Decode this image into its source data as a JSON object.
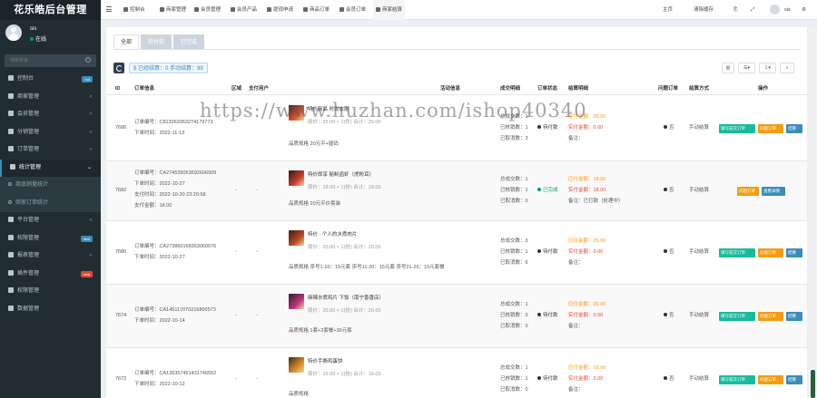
{
  "app": {
    "title": "花乐皓后台管理"
  },
  "user": {
    "name": "sis",
    "status": "在线"
  },
  "sidebar": {
    "search_placeholder": "搜索菜单",
    "items": [
      {
        "label": "控制台",
        "badge": "hot",
        "badge_color": "#3c8dbc"
      },
      {
        "label": "商家管理",
        "arrow": "‹"
      },
      {
        "label": "会员管理",
        "arrow": "‹"
      },
      {
        "label": "分销管理",
        "arrow": "‹"
      },
      {
        "label": "订单管理",
        "arrow": "‹"
      },
      {
        "label": "统计管理",
        "arrow": "⌄"
      },
      {
        "label": "商品销量统计"
      },
      {
        "label": "商家订单统计"
      },
      {
        "label": "平台管理",
        "arrow": "‹"
      },
      {
        "label": "权限管理",
        "badge": "new",
        "badge_color": "#3c8dbc"
      },
      {
        "label": "报表管理",
        "arrow": "‹"
      },
      {
        "label": "插件管理",
        "badge": "new",
        "badge_color": "#dd4b39"
      },
      {
        "label": "权限管理"
      },
      {
        "label": "数据管理"
      }
    ]
  },
  "topnav": {
    "items": [
      "控制台",
      "商家管理",
      "会员管理",
      "会员产品",
      "提现申请",
      "商品订单",
      "会员订单",
      "商家结算"
    ],
    "right": [
      "主页",
      "清除缓存"
    ],
    "user": "sis"
  },
  "tabs": [
    "全部",
    "待付款",
    "已完成"
  ],
  "toolbar": {
    "settle_label": "$ 已经结算：0 手动结算：99"
  },
  "table": {
    "headers": [
      "ID",
      "订单信息",
      "区域",
      "支付用户",
      "活动信息",
      "成交明细",
      "订单状态",
      "结算明细",
      "问题订单",
      "结算方式",
      "操作"
    ],
    "rows": [
      {
        "id": "7686",
        "order_no": "订单编号：C813363363274179773",
        "order_time": "下单时间：2022-11-13",
        "extra1": "",
        "extra2": "",
        "region": "",
        "buyer": "",
        "goods_name": "特价商品 时尚衣服",
        "goods_price": "原价：25.00 × 1(件)  合计：25.00",
        "spec": "品质规格 20元平+厘码",
        "deal": [
          "总成交数：1",
          "已核销数：1",
          "已取消数：3"
        ],
        "status": "待付款",
        "status_color": "#333333",
        "settle": [
          "应付金额：25.00",
          "实付金额：0.00",
          "备注："
        ],
        "problem": "否",
        "method": "手动结算",
        "ops": [
          "填写成交订单",
          "问题订单",
          "结算"
        ]
      },
      {
        "id": "7682",
        "order_no": "订单编号：CA274539053692606909",
        "order_time": "下单时间：2022-10-27",
        "extra1": "支付时间：2022-10-30 23:20:58",
        "extra2": "支付金额：18.00",
        "region": "-",
        "buyer": "-",
        "goods_name": "特价即享 秘制卤虾（虎粉耳）",
        "goods_price": "原价：18.00 × 1(份)  合计：18.00",
        "spec": "品质规格 20元平价套装",
        "deal": [
          "总成交数：1",
          "已核销数：1",
          "已取消数：0"
        ],
        "status": "已完成",
        "status_color": "#00a65a",
        "settle": [
          "应付金额：18.00",
          "实付金额：18.00",
          "备注：已打款（处理中）"
        ],
        "problem": "否",
        "method": "手动结算",
        "ops": [
          "问题订单",
          "查看详情"
        ]
      },
      {
        "id": "7680",
        "order_no": "订单编号：CA273860168363060076",
        "order_time": "下单时间：2022-10-27",
        "extra1": "",
        "extra2": "",
        "region": "-",
        "buyer": "-",
        "goods_name": "特价 · 个人的水煮肉片",
        "goods_price": "原价：20.00 × 1(份)  合计：20.00",
        "spec": "品质规格 序号1-10：15元套 序号11-20：15元套 序号21-25：15元套餐",
        "deal": [
          "总成交数：3",
          "已核销数：1",
          "已取消数：6"
        ],
        "status": "待付款",
        "status_color": "#333333",
        "settle": [
          "应付金额：20.00",
          "实付金额：0.00",
          "备注："
        ],
        "problem": "否",
        "method": "手动结算",
        "ops": [
          "填写成交订单",
          "问题订单",
          "结算"
        ]
      },
      {
        "id": "7674",
        "order_no": "订单编号：CA145117070216800573",
        "order_time": "下单时间：2022-10-14",
        "extra1": "",
        "extra2": "",
        "region": "-",
        "buyer": "-",
        "goods_name": "麻辣水煮鸡片 下饭（南宁香香店）",
        "goods_price": "原价：20.00 × 1(份)  合计：20.00",
        "spec": "品质规格 1套+2套餐+30元套",
        "deal": [
          "总成交数：1",
          "已核销数：0",
          "已取消数：0"
        ],
        "status": "待付款",
        "status_color": "#333333",
        "settle": [
          "应付金额：20.00",
          "实付金额：0.00",
          "备注："
        ],
        "problem": "否",
        "method": "手动结算",
        "ops": [
          "填写成交订单",
          "问题订单",
          "结算"
        ]
      },
      {
        "id": "7672",
        "order_no": "订单编号：CA126357451431746552",
        "order_time": "下单时间：2022-10-12",
        "extra1": "",
        "extra2": "",
        "region": "-",
        "buyer": "-",
        "goods_name": "特价手撕鸡蛋饼",
        "goods_price": "原价：16.00 × 1(份)  合计：16.00",
        "spec": "品质规格",
        "deal": [
          "总成交数：1",
          "已核销数：1",
          "已取消数：0"
        ],
        "status": "待付款",
        "status_color": "#333333",
        "settle": [
          "应付金额：16.00",
          "实付金额：0.00",
          "备注："
        ],
        "problem": "否",
        "method": "手动结算",
        "ops": [
          "填写成交订单",
          "问题订单",
          "结算"
        ]
      }
    ]
  },
  "watermark": "https://www.huzhan.com/ishop40340"
}
